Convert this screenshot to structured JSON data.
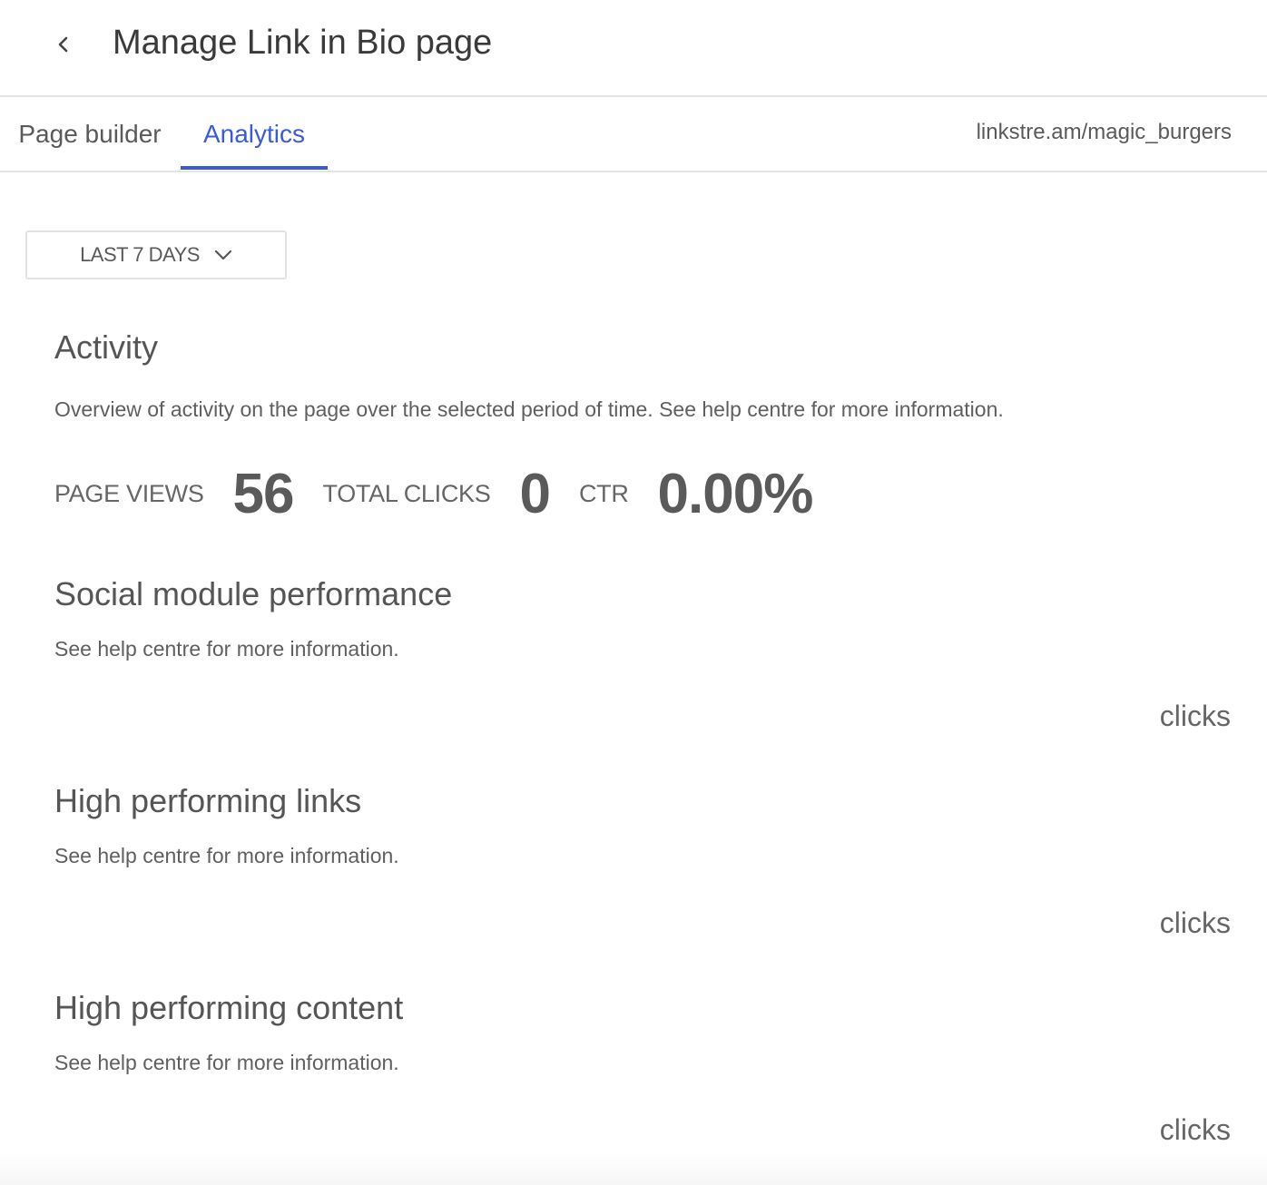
{
  "header": {
    "title": "Manage Link in Bio page",
    "back_icon": "chevron-left-icon"
  },
  "tabs": [
    {
      "label": "Page builder",
      "active": false
    },
    {
      "label": "Analytics",
      "active": true
    }
  ],
  "page_url": "linkstre.am/magic_burgers",
  "accent_color": "#3a5bd9",
  "date_range": {
    "selected": "LAST 7 DAYS",
    "icon": "chevron-down-icon"
  },
  "activity": {
    "title": "Activity",
    "description": "Overview of activity on the page over the selected period of time. See help centre for more information.",
    "stats": [
      {
        "label": "PAGE VIEWS",
        "value": "56"
      },
      {
        "label": "TOTAL CLICKS",
        "value": "0"
      },
      {
        "label": "CTR",
        "value": "0.00%"
      }
    ]
  },
  "sections": [
    {
      "title": "Social module performance",
      "description": "See help centre for more information.",
      "metric_label": "clicks"
    },
    {
      "title": "High performing links",
      "description": "See help centre for more information.",
      "metric_label": "clicks"
    },
    {
      "title": "High performing content",
      "description": "See help centre for more information.",
      "metric_label": "clicks"
    }
  ]
}
